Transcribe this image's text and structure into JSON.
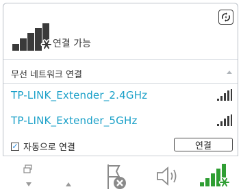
{
  "status": {
    "label": "연결 가능",
    "icon": "signal-bars-available-icon"
  },
  "refresh": {
    "icon": "refresh-icon"
  },
  "section": {
    "header": "무선 네트워크 연결",
    "collapse_icon": "triangle-up-icon"
  },
  "networks": [
    {
      "ssid": "TP-LINK_Extender_2.4GHz",
      "signal_icon": "signal-strength-icon"
    },
    {
      "ssid": "TP-LINK_Extender_5GHz",
      "signal_icon": "signal-strength-icon"
    }
  ],
  "auto_connect": {
    "label": "자동으로 연결",
    "checked": true
  },
  "connect_button": {
    "label": "연결"
  },
  "taskbar": {
    "icons": [
      "windows-icon",
      "arrow-down-icon",
      "arrow-up-icon",
      "flag-error-icon",
      "speaker-icon",
      "wifi-available-icon"
    ]
  },
  "colors": {
    "accent": "#1aa0c8",
    "icon_green": "#2f9e33"
  }
}
